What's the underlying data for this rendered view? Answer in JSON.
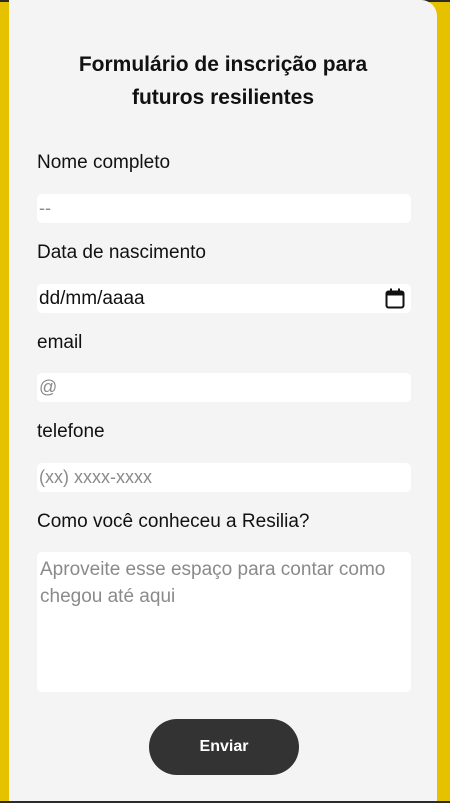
{
  "form": {
    "title": "Formulário de inscrição para futuros resilientes",
    "fields": {
      "name": {
        "label": "Nome completo",
        "placeholder": "--"
      },
      "birthdate": {
        "label": "Data de nascimento",
        "value": "dd/mm/aaaa"
      },
      "email": {
        "label": "email",
        "placeholder": "@"
      },
      "phone": {
        "label": "telefone",
        "placeholder": "(xx) xxxx-xxxx"
      },
      "source": {
        "label": "Como você conheceu a Resilia?",
        "placeholder": "Aproveite esse espaço para contar como chegou até aqui"
      }
    },
    "submit_label": "Enviar"
  },
  "colors": {
    "background": "#e5c100",
    "card": "#f4f4f4",
    "button": "#333333"
  }
}
